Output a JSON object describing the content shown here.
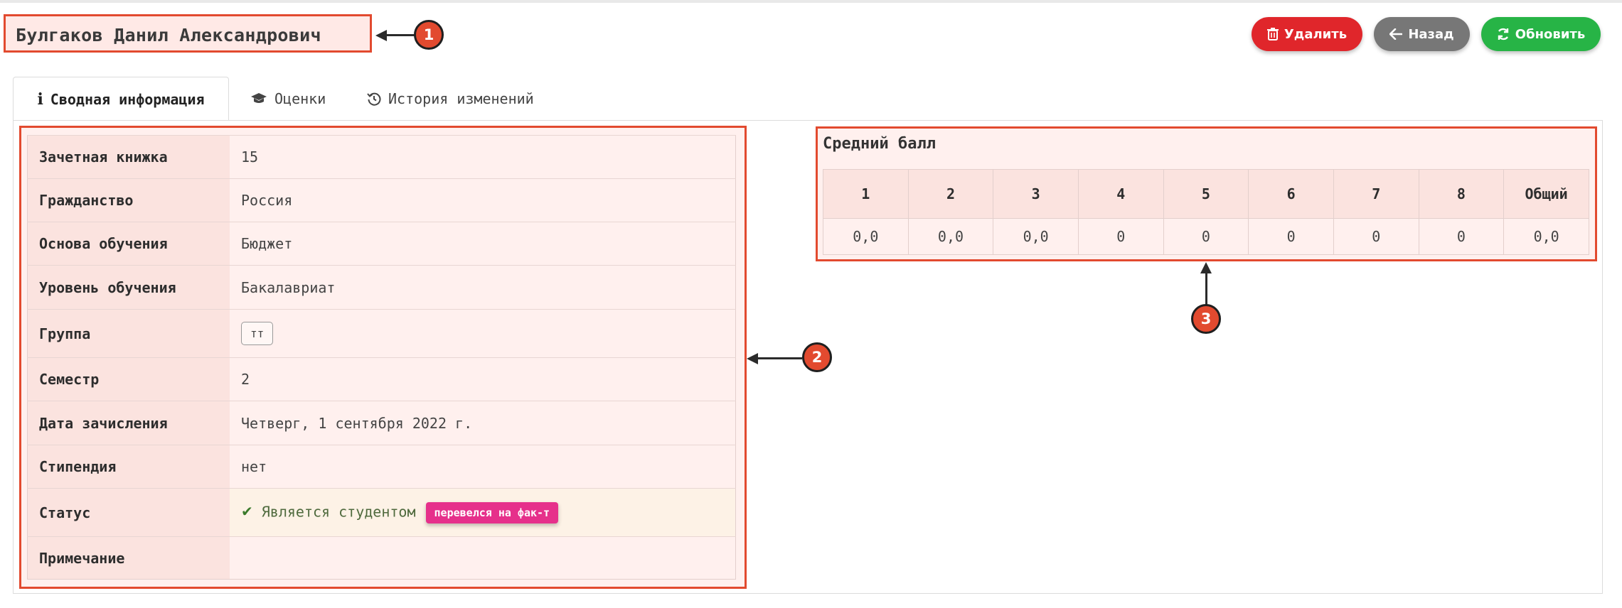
{
  "header": {
    "student_name": "Булгаков Данил Александрович"
  },
  "buttons": {
    "delete": "Удалить",
    "back": "Назад",
    "refresh": "Обновить"
  },
  "tabs": [
    {
      "label": "Сводная информация",
      "icon": "info-icon"
    },
    {
      "label": "Оценки",
      "icon": "graduation-cap-icon"
    },
    {
      "label": "История изменений",
      "icon": "history-icon"
    }
  ],
  "info": {
    "rows": [
      {
        "key": "Зачетная книжка",
        "value": "15"
      },
      {
        "key": "Гражданство",
        "value": "Россия"
      },
      {
        "key": "Основа обучения",
        "value": "Бюджет"
      },
      {
        "key": "Уровень обучения",
        "value": "Бакалавриат"
      },
      {
        "key": "Группа",
        "value": "тт"
      },
      {
        "key": "Семестр",
        "value": "2"
      },
      {
        "key": "Дата зачисления",
        "value": "Четверг, 1 сентября 2022 г."
      },
      {
        "key": "Стипендия",
        "value": "нет"
      },
      {
        "key": "Статус",
        "value": "Является студентом",
        "badge": "перевелся на фак-т"
      },
      {
        "key": "Примечание",
        "value": ""
      }
    ]
  },
  "average": {
    "title": "Средний балл",
    "headers": [
      "1",
      "2",
      "3",
      "4",
      "5",
      "6",
      "7",
      "8",
      "Общий"
    ],
    "values": [
      "0,0",
      "0,0",
      "0,0",
      "0",
      "0",
      "0",
      "0",
      "0",
      "0,0"
    ]
  },
  "callouts": [
    "1",
    "2",
    "3"
  ],
  "colors": {
    "highlight": "#e24a2f",
    "delete": "#e0262b",
    "back": "#777777",
    "refresh": "#27b446",
    "badge": "#e6308b"
  }
}
